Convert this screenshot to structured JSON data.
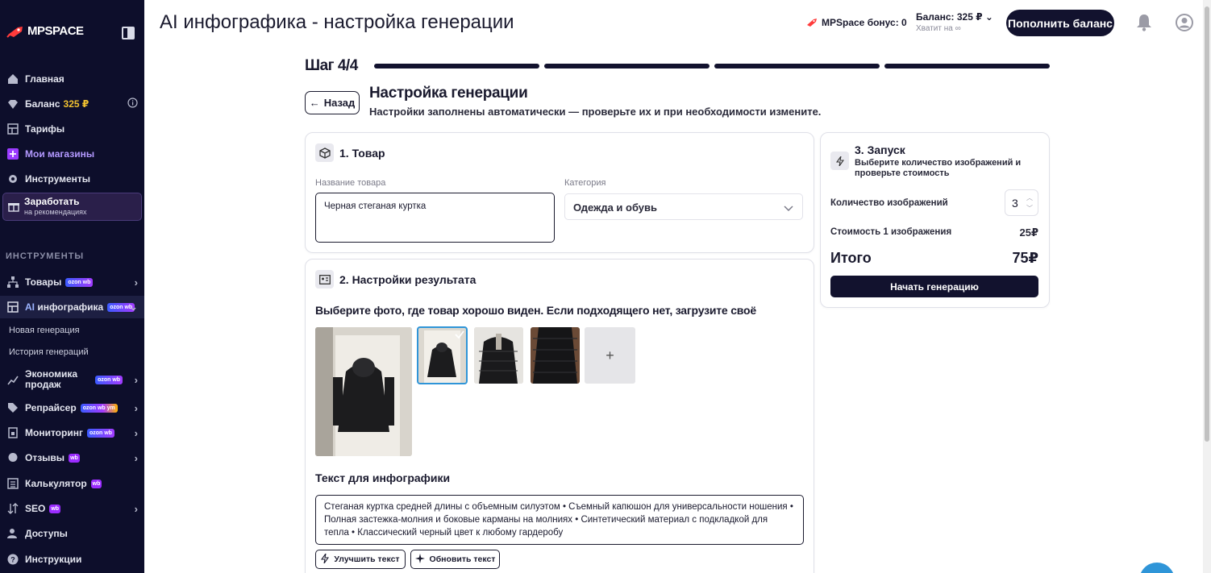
{
  "sidebar": {
    "logo": "MPSPACE",
    "nav": [
      {
        "label": "Главная"
      },
      {
        "label": "Баланс",
        "value": "325 ₽"
      },
      {
        "label": "Тарифы"
      },
      {
        "label": "Мои магазины"
      },
      {
        "label": "Инструменты"
      }
    ],
    "earn": {
      "title": "Заработать",
      "subtitle": "на рекомендациях"
    },
    "section_title": "ИНСТРУМЕНТЫ",
    "tools": [
      {
        "label": "Товары",
        "badge": "ozon wb"
      },
      {
        "label": "AI инфографика",
        "label_prefix": "AI",
        "label_rest": " инфографика",
        "badge": "ozon wb"
      },
      {
        "label": "Экономика продаж",
        "badge": "ozon wb"
      },
      {
        "label": "Репрайсер",
        "badge": "ozon wb ym"
      },
      {
        "label": "Мониторинг",
        "badge": "ozon wb"
      },
      {
        "label": "Отзывы",
        "badge": "wb"
      },
      {
        "label": "Калькулятор",
        "badge": "wb"
      },
      {
        "label": "SEO",
        "badge": "wb"
      },
      {
        "label": "Доступы"
      },
      {
        "label": "Инструкции"
      }
    ],
    "sub_items": [
      "Новая генерация",
      "История генераций"
    ],
    "econ_line1": "Экономика",
    "econ_line2": "продаж"
  },
  "header": {
    "title": "AI инфографика - настройка генерации",
    "bonus": "MPSpace бонус: 0",
    "balance": "Баланс: 325 ₽",
    "balance_sub": "Хватит на ∞",
    "topup": "Пополнить баланс"
  },
  "step": {
    "label": "Шаг 4/4"
  },
  "back": "Назад",
  "generation": {
    "title": "Настройка генерации",
    "subtitle": "Настройки заполнены автоматически — проверьте их и при необходимости измените."
  },
  "product": {
    "heading": "1. Товар",
    "name_label": "Название товара",
    "name_value": "Черная стеганая куртка",
    "category_label": "Категория",
    "category_value": "Одежда и обувь"
  },
  "result": {
    "heading": "2. Настройки результата",
    "photo_prompt": "Выберите фото, где товар хорошо виден. Если подходящего нет, загрузите своё",
    "text_label": "Текст для инфографики",
    "text_value": "Стеганая куртка средней длины с объемным силуэтом • Съемный капюшон для универсальности ношения • Полная застежка-молния и боковые карманы на молниях • Синтетический материал с подкладкой для тепла • Классический черный цвет к любому гардеробу",
    "improve_btn": "Улучшить текст",
    "refresh_btn": "Обновить текст"
  },
  "launch": {
    "heading": "3. Запуск",
    "subtitle": "Выберите количество изображений и проверьте стоимость",
    "qty_label": "Количество изображений",
    "qty_value": "3",
    "price_label": "Стоимость 1 изображения",
    "price_value": "25₽",
    "total_label": "Итого",
    "total_value": "75₽",
    "start_btn": "Начать генерацию"
  },
  "colors": {
    "sidebar": "#0d0e2b",
    "primary": "#12122e",
    "accent_selected": "#2f95d8",
    "balance_gold": "#f2c230"
  }
}
